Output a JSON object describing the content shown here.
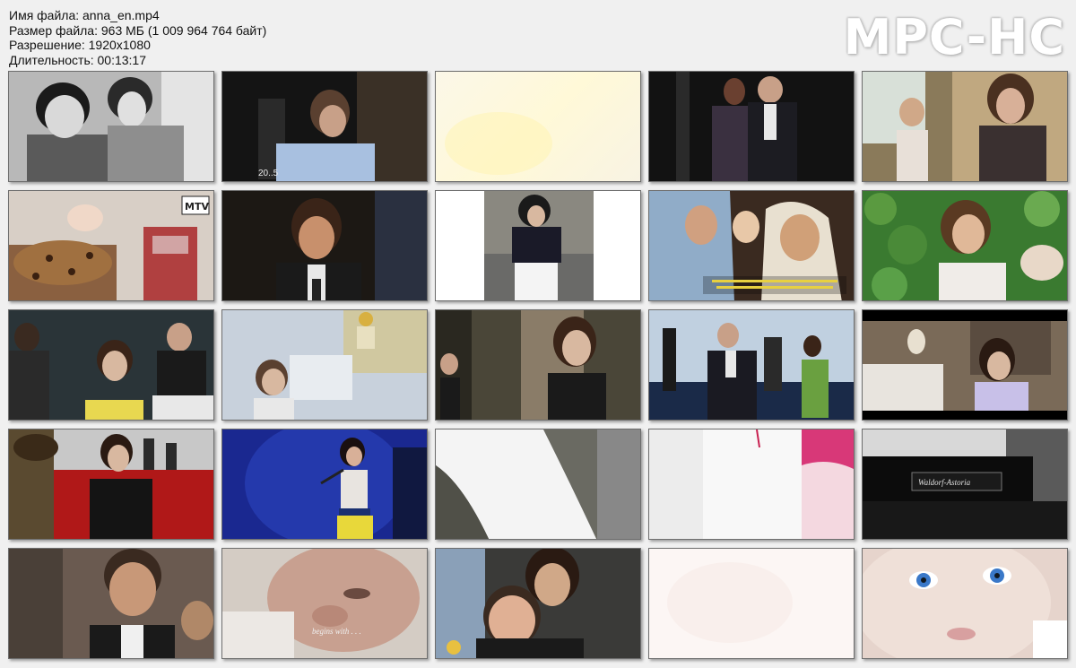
{
  "info": {
    "filename": "Имя файла: anna_en.mp4",
    "filesize": "Размер файла: 963 МБ (1 009 964 764 байт)",
    "resolution": "Разрешение: 1920x1080",
    "duration": "Длительность: 00:13:17"
  },
  "logo": "MPC-HC",
  "thumbnails": {
    "r1c2": {
      "timestamp": "20..5"
    },
    "r2c1": {
      "logo": "MTV"
    },
    "r4c5": {
      "sign": "Waldorf-Astoria"
    },
    "r5c2": {
      "caption": "begins with . . ."
    }
  }
}
